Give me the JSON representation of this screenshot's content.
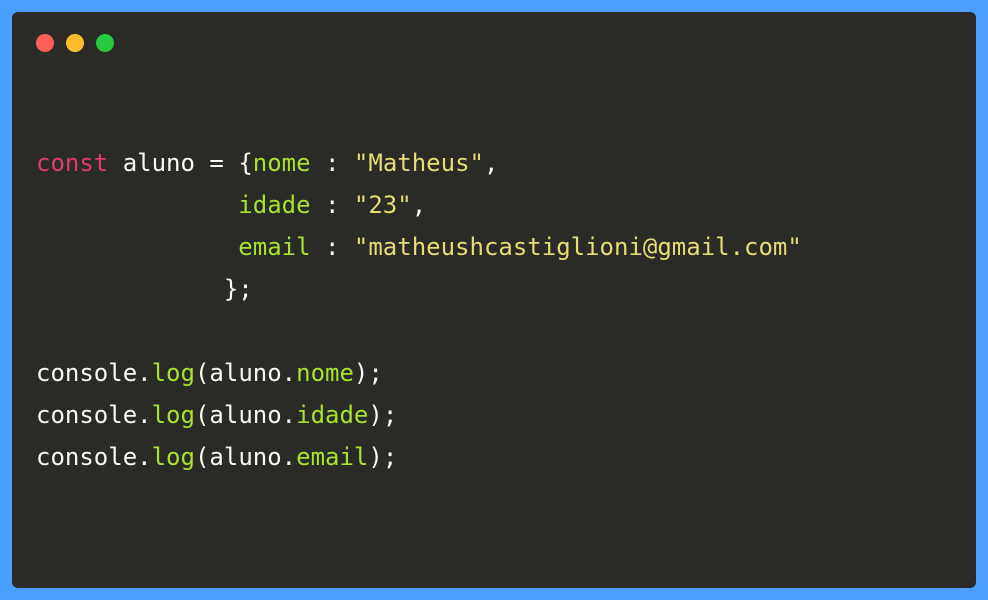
{
  "window": {
    "traffic_lights": [
      "red",
      "yellow",
      "green"
    ]
  },
  "code": {
    "line1": {
      "keyword": "const",
      "identifier": "aluno",
      "operator": "=",
      "brace_open": "{",
      "prop": "nome",
      "colon": " :",
      "string": "\"Matheus\"",
      "comma": ","
    },
    "line2": {
      "indent": "              ",
      "prop": "idade",
      "colon": " :",
      "string": "\"23\"",
      "comma": ","
    },
    "line3": {
      "indent": "              ",
      "prop": "email",
      "colon": " :",
      "string": "\"matheushcastiglioni@gmail.com\""
    },
    "line4": {
      "indent": "             ",
      "brace_close": "}",
      "semi": ";"
    },
    "line5": {
      "obj": "console",
      "dot": ".",
      "fn": "log",
      "paren_open": "(",
      "arg_obj": "aluno",
      "arg_dot": ".",
      "arg_prop": "nome",
      "paren_close": ")",
      "semi": ";"
    },
    "line6": {
      "obj": "console",
      "dot": ".",
      "fn": "log",
      "paren_open": "(",
      "arg_obj": "aluno",
      "arg_dot": ".",
      "arg_prop": "idade",
      "paren_close": ")",
      "semi": ";"
    },
    "line7": {
      "obj": "console",
      "dot": ".",
      "fn": "log",
      "paren_open": "(",
      "arg_obj": "aluno",
      "arg_dot": ".",
      "arg_prop": "email",
      "paren_close": ")",
      "semi": ";"
    }
  }
}
